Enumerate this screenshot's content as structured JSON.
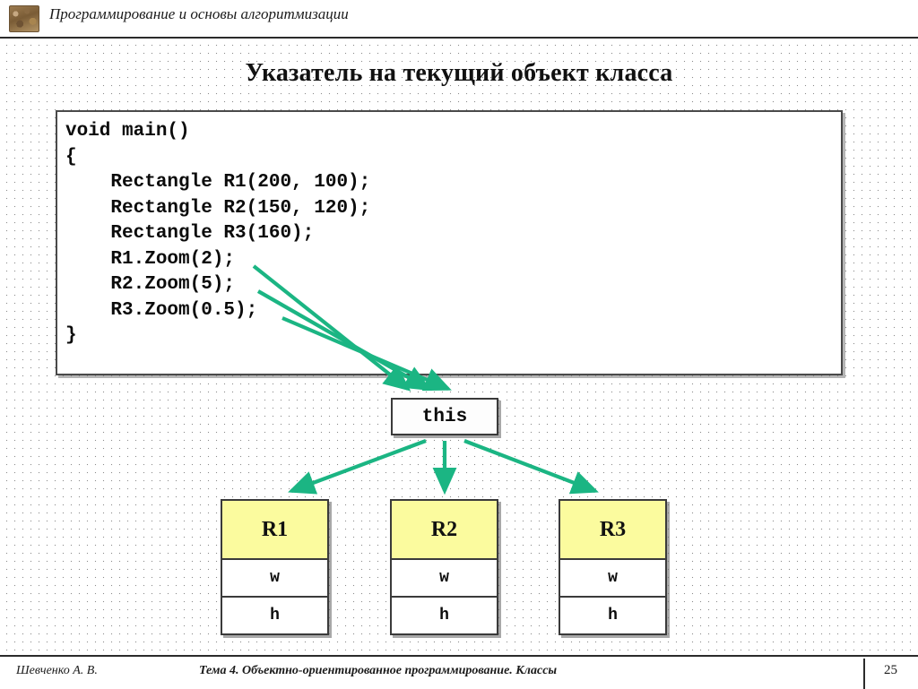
{
  "header": {
    "icon": "book-stack-icon",
    "title": "Программирование и основы алгоритмизации"
  },
  "slide": {
    "title": "Указатель на текущий объект класса"
  },
  "code_block": {
    "language": "cpp",
    "text": "void main()\n{\n    Rectangle R1(200, 100);\n    Rectangle R2(150, 120);\n    Rectangle R3(160);\n    R1.Zoom(2);\n    R2.Zoom(5);\n    R3.Zoom(0.5);\n}",
    "lines": [
      "void main()",
      "{",
      "    Rectangle R1(200, 100);",
      "    Rectangle R2(150, 120);",
      "    Rectangle R3(160);",
      "    R1.Zoom(2);",
      "    R2.Zoom(5);",
      "    R3.Zoom(0.5);",
      "}"
    ]
  },
  "diagram": {
    "pointer_node": {
      "label": "this"
    },
    "objects": [
      {
        "name": "R1",
        "fields": [
          "w",
          "h"
        ]
      },
      {
        "name": "R2",
        "fields": [
          "w",
          "h"
        ]
      },
      {
        "name": "R3",
        "fields": [
          "w",
          "h"
        ]
      }
    ],
    "arrow_color": "#1BB583",
    "header_fill": "#FBFB9E"
  },
  "footer": {
    "author": "Шевченко А. В.",
    "topic": "Тема 4. Объектно-ориентированное программирование. Классы",
    "page": "25"
  }
}
